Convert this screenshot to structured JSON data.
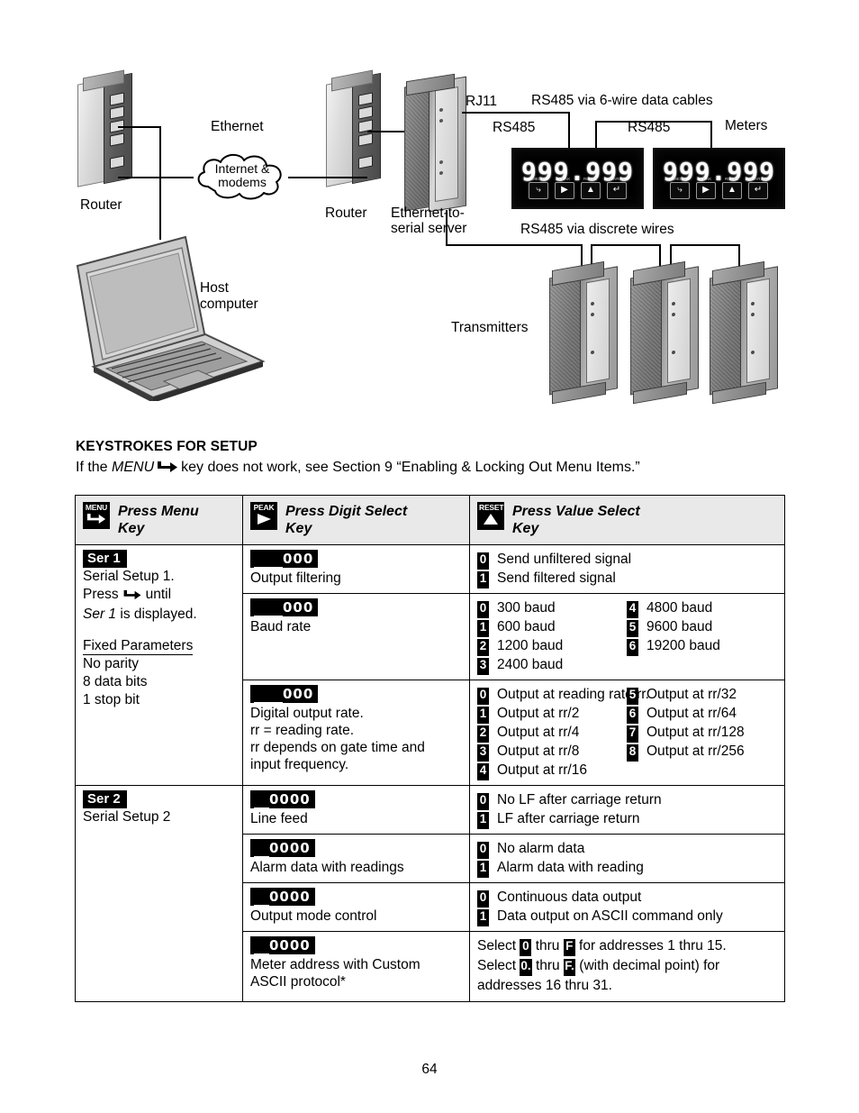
{
  "diagram": {
    "labels": {
      "router_left": "Router",
      "router_right": "Router",
      "ethernet": "Ethernet",
      "cloud": "Internet &\nmodems",
      "host_computer": "Host\ncomputer",
      "ethernet_serial_server": "Ethernet-to-\nserial server",
      "rj11": "RJ11",
      "rs485_6wire": "RS485 via 6-wire data cables",
      "rs485_a": "RS485",
      "rs485_b": "RS485",
      "meters": "Meters",
      "rs485_discrete": "RS485 via discrete wires",
      "transmitters": "Transmitters"
    },
    "meter_display": "999.999",
    "meter_keys": [
      {
        "caption": "MENU",
        "glyph": "⤷"
      },
      {
        "caption": "PEAK",
        "glyph": "▶"
      },
      {
        "caption": "RESET",
        "glyph": "▲"
      },
      {
        "caption": "ALARMS",
        "glyph": "↵"
      }
    ]
  },
  "section": {
    "heading": "KEYSTROKES FOR SETUP",
    "intro_before": "If the ",
    "intro_italic": "MENU",
    "intro_after": "key does not work, see Section 9 “Enabling & Locking Out Menu Items.”"
  },
  "table": {
    "headers": [
      {
        "icon_caption": "MENU",
        "icon_glyph": "⤷",
        "icon_name": "menu-key-icon",
        "label": "Press Menu\nKey"
      },
      {
        "icon_caption": "PEAK",
        "icon_glyph": "▶",
        "icon_name": "digit-select-key-icon",
        "label": "Press Digit Select\nKey"
      },
      {
        "icon_caption": "RESET",
        "icon_glyph": "▲",
        "icon_name": "value-select-key-icon",
        "label": "Press Value Select\nKey"
      }
    ],
    "ser1": {
      "badge": "Ser 1",
      "line1": "Serial Setup 1.",
      "line2_before": "Press",
      "line2_after": "until",
      "line3_italic": "Ser 1",
      "line3_rest": " is displayed.",
      "fixed_heading": "Fixed Parameters",
      "fixed_items": [
        "No parity",
        "8 data bits",
        "1 stop bit"
      ]
    },
    "ser2": {
      "badge": "Ser 2",
      "line1": "Serial Setup 2"
    },
    "rows": [
      {
        "lcd_blank": " ",
        "lcd_digits": "000",
        "lcd_underline_index": 0,
        "caption": "Output filtering",
        "options": [
          {
            "code": "0",
            "text": "Send unfiltered signal",
            "underline": true
          },
          {
            "code": "1",
            "text": "Send filtered signal",
            "underline": true
          }
        ],
        "options_b": []
      },
      {
        "lcd_blank": " ",
        "lcd_digits": "000",
        "lcd_underline_index": 0,
        "caption": "Baud rate",
        "options": [
          {
            "code": "0",
            "text": "300 baud",
            "underline": true
          },
          {
            "code": "1",
            "text": "600 baud",
            "underline": true
          },
          {
            "code": "2",
            "text": "1200 baud",
            "underline": true
          },
          {
            "code": "3",
            "text": "2400 baud",
            "underline": true
          }
        ],
        "options_b": [
          {
            "code": "4",
            "text": "4800 baud",
            "underline": true
          },
          {
            "code": "5",
            "text": "9600 baud",
            "underline": true
          },
          {
            "code": "6",
            "text": "19200 baud",
            "underline": true
          }
        ]
      },
      {
        "lcd_blank": " ",
        "lcd_digits": "000",
        "lcd_underline_index": 0,
        "caption": "Digital output rate.\nrr = reading rate.\nrr depends on gate time and\ninput frequency.",
        "options": [
          {
            "code": "0",
            "text": "Output at reading rate rr.",
            "underline": true
          },
          {
            "code": "1",
            "text": "Output at rr/2",
            "underline": true
          },
          {
            "code": "2",
            "text": "Output at rr/4",
            "underline": true
          },
          {
            "code": "3",
            "text": "Output at rr/8",
            "underline": true
          },
          {
            "code": "4",
            "text": "Output at rr/16",
            "underline": true
          }
        ],
        "options_b": [
          {
            "code": "5",
            "text": "Output at rr/32",
            "underline": true
          },
          {
            "code": "6",
            "text": "Output at rr/64",
            "underline": true
          },
          {
            "code": "7",
            "text": "Output at rr/128",
            "underline": true
          },
          {
            "code": "8",
            "text": "Output at rr/256",
            "underline": true
          }
        ]
      },
      {
        "lcd_blank": " ",
        "lcd_digits": "0000",
        "lcd_underline_index": 0,
        "caption": "Line feed",
        "options": [
          {
            "code": "0",
            "text": "No LF after carriage return",
            "underline": true
          },
          {
            "code": "1",
            "text": "LF after carriage return",
            "underline": true
          }
        ],
        "options_b": []
      },
      {
        "lcd_blank": " ",
        "lcd_digits": "0000",
        "lcd_underline_index": 0,
        "caption": "Alarm data with readings",
        "options": [
          {
            "code": "0",
            "text": "No alarm data",
            "underline": true
          },
          {
            "code": "1",
            "text": "Alarm data with reading",
            "underline": true
          }
        ],
        "options_b": []
      },
      {
        "lcd_blank": " ",
        "lcd_digits": "0000",
        "lcd_underline_index": 0,
        "caption": "Output mode control",
        "options": [
          {
            "code": "0",
            "text": "Continuous data output",
            "underline": true
          },
          {
            "code": "1",
            "text": "Data output on ASCII command only",
            "underline": true
          }
        ],
        "options_b": []
      },
      {
        "lcd_blank": " ",
        "lcd_digits": "0000",
        "lcd_underline_index": 0,
        "caption": "Meter address with Custom\nASCII protocol*",
        "free_text": {
          "l1_a": "Select",
          "l1_chip1": "0",
          "l1_b": "thru",
          "l1_chip2": "F",
          "l1_c": "for addresses 1 thru 15.",
          "l2_a": "Select",
          "l2_chip1": "0.",
          "l2_b": "thru",
          "l2_chip2": "F.",
          "l2_c": "(with decimal point) for",
          "l3": "addresses 16 thru 31."
        },
        "options": [],
        "options_b": []
      }
    ]
  },
  "page_number": "64"
}
